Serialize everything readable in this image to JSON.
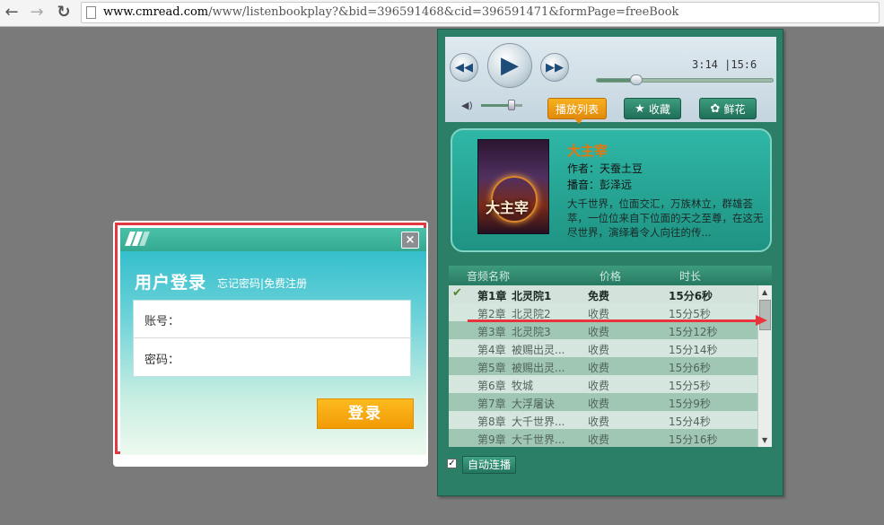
{
  "browser": {
    "url_host": "www.cmread.com",
    "url_path": "/www/listenbookplay?&bid=396591468&cid=396591471&formPage=freeBook"
  },
  "player": {
    "time_current": "3:14",
    "time_total": "15:6",
    "progress_fraction": 0.21,
    "volume_fraction": 0.65,
    "tabs": {
      "playlist": "播放列表",
      "favorite": "收藏",
      "flower": "鲜花"
    }
  },
  "book": {
    "cover_text": "大主宰",
    "title": "大主宰",
    "author": "作者：天蚕土豆",
    "reader": "播音：彭泽远",
    "description": "大千世界，位面交汇，万族林立，群雄荟萃，一位位来自下位面的天之至尊，在这无尽世界，演绎着令人向往的传..."
  },
  "playlist": {
    "headers": {
      "name": "音频名称",
      "price": "价格",
      "duration": "时长"
    },
    "rows": [
      {
        "chapter": "第1章",
        "name": "北灵院1",
        "price": "免费",
        "duration": "15分6秒"
      },
      {
        "chapter": "第2章",
        "name": "北灵院2",
        "price": "收费",
        "duration": "15分5秒"
      },
      {
        "chapter": "第3章",
        "name": "北灵院3",
        "price": "收费",
        "duration": "15分12秒"
      },
      {
        "chapter": "第4章",
        "name": "被赐出灵...",
        "price": "收费",
        "duration": "15分14秒"
      },
      {
        "chapter": "第5章",
        "name": "被赐出灵...",
        "price": "收费",
        "duration": "15分6秒"
      },
      {
        "chapter": "第6章",
        "name": "牧城",
        "price": "收费",
        "duration": "15分5秒"
      },
      {
        "chapter": "第7章",
        "name": "大浮屠诀",
        "price": "收费",
        "duration": "15分9秒"
      },
      {
        "chapter": "第8章",
        "name": "大千世界...",
        "price": "收费",
        "duration": "15分4秒"
      },
      {
        "chapter": "第9章",
        "name": "大千世界...",
        "price": "收费",
        "duration": "15分16秒"
      }
    ],
    "auto_continue": "自动连播"
  },
  "login": {
    "title": "用户登录",
    "forgot": "忘记密码",
    "separator": "|",
    "register": "免费注册",
    "user_label": "账号：",
    "pass_label": "密码：",
    "submit": "登录"
  },
  "colors": {
    "annotation": "#e8343a",
    "accent": "#f29b05",
    "player_bg": "#2a7f66"
  }
}
